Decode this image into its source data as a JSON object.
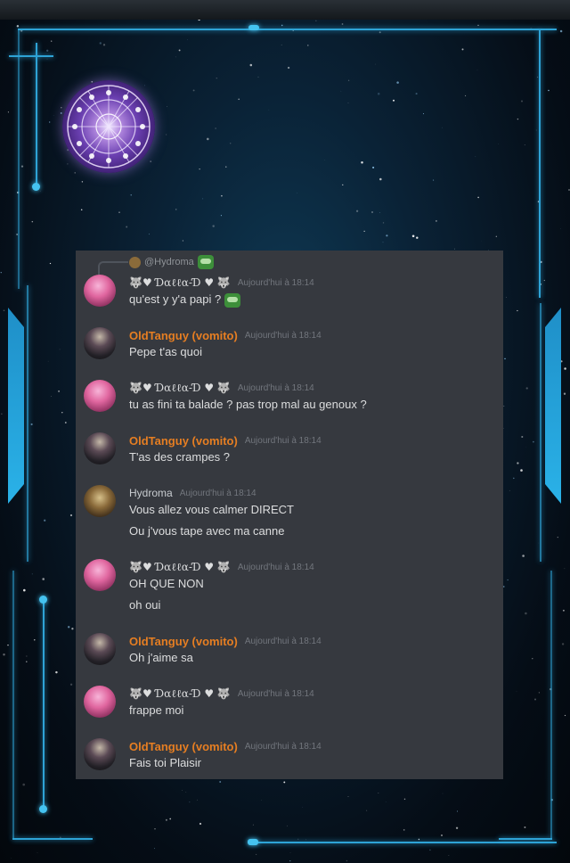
{
  "reply": {
    "author": "@Hydroma"
  },
  "messages": [
    {
      "author": "🐺♥ Ɗαℓℓα-Ɗ ♥ 🐺",
      "time": "Aujourd'hui à 18:14",
      "lines": [
        "qu'est y y'a papi ?"
      ]
    },
    {
      "author": "OldTanguy (vomito)",
      "time": "Aujourd'hui à 18:14",
      "lines": [
        "Pepe t'as quoi"
      ]
    },
    {
      "author": "🐺♥ Ɗαℓℓα-Ɗ ♥ 🐺",
      "time": "Aujourd'hui à 18:14",
      "lines": [
        "tu as fini ta balade ? pas trop mal au genoux ?"
      ]
    },
    {
      "author": "OldTanguy (vomito)",
      "time": "Aujourd'hui à 18:14",
      "lines": [
        "T'as des crampes ?"
      ]
    },
    {
      "author": "Hydroma",
      "time": "Aujourd'hui à 18:14",
      "lines": [
        "Vous allez vous calmer DIRECT",
        "Ou j'vous tape avec ma canne"
      ]
    },
    {
      "author": "🐺♥ Ɗαℓℓα-Ɗ ♥ 🐺",
      "time": "Aujourd'hui à 18:14",
      "lines": [
        "OH QUE NON",
        "oh oui"
      ]
    },
    {
      "author": "OldTanguy (vomito)",
      "time": "Aujourd'hui à 18:14",
      "lines": [
        "Oh j'aime sa"
      ]
    },
    {
      "author": "🐺♥ Ɗαℓℓα-Ɗ ♥ 🐺",
      "time": "Aujourd'hui à 18:14",
      "lines": [
        "frappe moi"
      ]
    },
    {
      "author": "OldTanguy (vomito)",
      "time": "Aujourd'hui à 18:14",
      "lines": [
        "Fais toi Plaisir"
      ]
    }
  ],
  "colors": {
    "chat_bg": "#36393f",
    "orange_role": "#e67e22",
    "frame_accent": "#2ea3d6"
  }
}
